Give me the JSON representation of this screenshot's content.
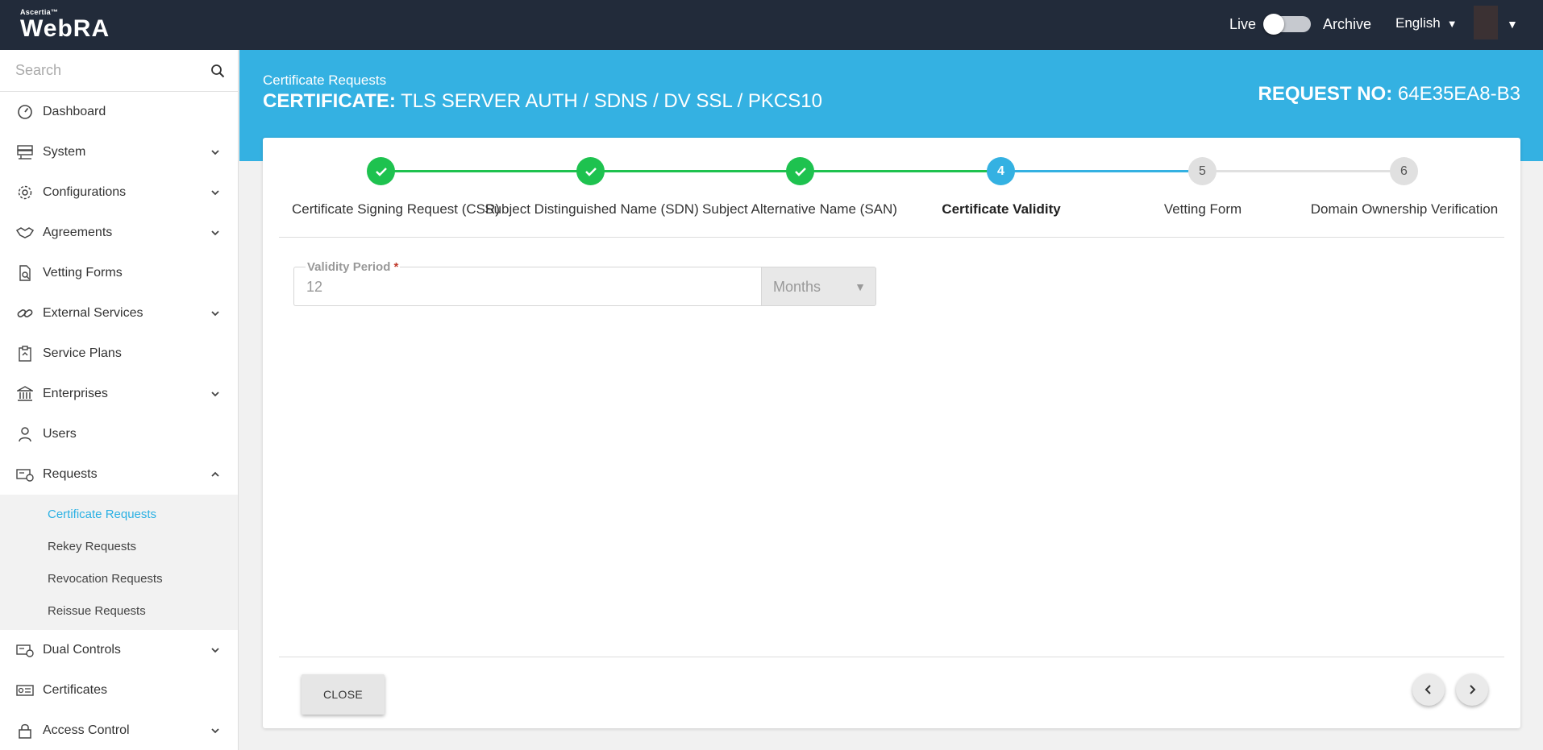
{
  "header": {
    "brand_small": "Ascertia™",
    "brand": "WebRA",
    "mode_live": "Live",
    "mode_archive": "Archive",
    "language": "English"
  },
  "sidebar": {
    "search_placeholder": "Search",
    "items": [
      {
        "label": "Dashboard",
        "icon": "dashboard-icon",
        "expandable": false
      },
      {
        "label": "System",
        "icon": "server-icon",
        "expandable": true
      },
      {
        "label": "Configurations",
        "icon": "gear-icon",
        "expandable": true
      },
      {
        "label": "Agreements",
        "icon": "handshake-icon",
        "expandable": true
      },
      {
        "label": "Vetting Forms",
        "icon": "document-search-icon",
        "expandable": false
      },
      {
        "label": "External Services",
        "icon": "link-icon",
        "expandable": true
      },
      {
        "label": "Service Plans",
        "icon": "clipboard-icon",
        "expandable": false
      },
      {
        "label": "Enterprises",
        "icon": "bank-icon",
        "expandable": true
      },
      {
        "label": "Users",
        "icon": "user-icon",
        "expandable": false
      },
      {
        "label": "Requests",
        "icon": "request-card-icon",
        "expanded": true
      },
      {
        "label": "Dual Controls",
        "icon": "dual-card-icon",
        "expandable": true
      },
      {
        "label": "Certificates",
        "icon": "certificate-icon",
        "expandable": false
      },
      {
        "label": "Access Control",
        "icon": "lock-icon",
        "expandable": true
      }
    ],
    "request_subitems": [
      "Certificate Requests",
      "Rekey Requests",
      "Revocation Requests",
      "Reissue Requests"
    ],
    "active_subitem": "Certificate Requests"
  },
  "page": {
    "breadcrumb": "Certificate Requests",
    "title_prefix": "CERTIFICATE:",
    "title_value": "TLS SERVER AUTH / SDNS / DV SSL / PKCS10",
    "request_no_label": "REQUEST NO:",
    "request_no_value": "64E35EA8-B3"
  },
  "stepper": {
    "steps": [
      {
        "number": "1",
        "label": "Certificate Signing Request (CSR)",
        "status": "done"
      },
      {
        "number": "2",
        "label": "Subject Distinguished Name (SDN)",
        "status": "done"
      },
      {
        "number": "3",
        "label": "Subject Alternative Name (SAN)",
        "status": "done"
      },
      {
        "number": "4",
        "label": "Certificate Validity",
        "status": "current"
      },
      {
        "number": "5",
        "label": "Vetting Form",
        "status": "todo"
      },
      {
        "number": "6",
        "label": "Domain Ownership Verification",
        "status": "todo"
      }
    ],
    "colors": {
      "done": "#1ec24f",
      "current": "#34b1e2",
      "todo": "#e0e0e0"
    }
  },
  "form": {
    "validity_label": "Validity Period",
    "required_mark": "*",
    "validity_value": "12",
    "unit_value": "Months"
  },
  "footer": {
    "close_label": "CLOSE"
  }
}
